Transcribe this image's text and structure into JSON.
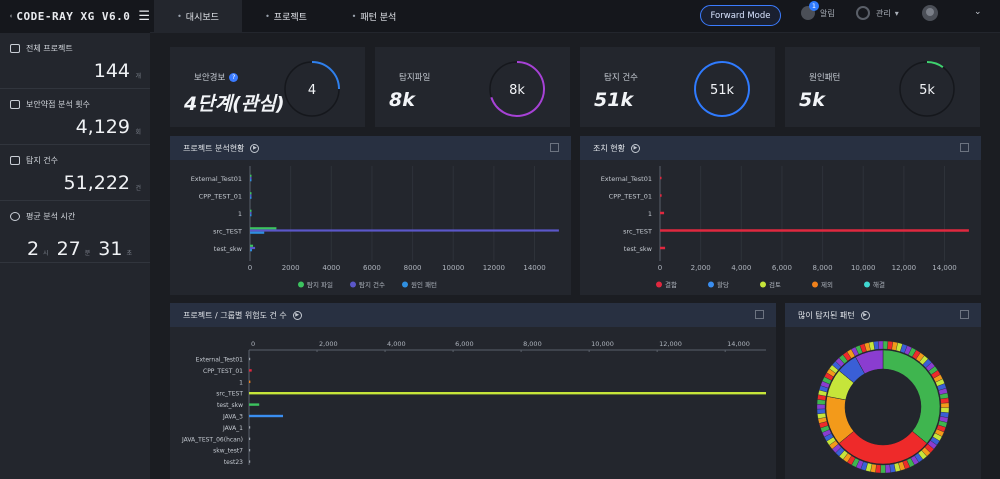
{
  "app": {
    "logo": "CODE-RAY XG V6.0"
  },
  "nav": {
    "tabs": [
      "대시보드",
      "프로젝트",
      "패턴 분석"
    ],
    "active": 0
  },
  "header": {
    "forward_mode": "Forward Mode",
    "alarm_label": "알림",
    "alarm_count": "1",
    "manage_label": "관리"
  },
  "sidebar": {
    "stats": [
      {
        "label": "전체 프로젝트",
        "value": "144",
        "unit": "개"
      },
      {
        "label": "보안약점 분석 횟수",
        "value": "4,129",
        "unit": "회"
      },
      {
        "label": "탐지 건수",
        "value": "51,222",
        "unit": "건"
      }
    ],
    "avg_time": {
      "label": "평균 분석 시간",
      "h": "2",
      "h_unit": "시",
      "m": "27",
      "m_unit": "분",
      "s": "31",
      "s_unit": "초"
    }
  },
  "kpis": [
    {
      "label": "보안경보",
      "value": "4단계(관심)",
      "ring": "4",
      "fraction": 0.25,
      "color": "#2f80ed",
      "help": "?"
    },
    {
      "label": "탐지파일",
      "value": "8k",
      "ring": "8k",
      "fraction": 0.7,
      "color": "#a742d6"
    },
    {
      "label": "탐지 건수",
      "value": "51k",
      "ring": "51k",
      "fraction": 1.0,
      "color": "#2f7bff"
    },
    {
      "label": "원인패턴",
      "value": "5k",
      "ring": "5k",
      "fraction": 0.1,
      "color": "#3fd36f"
    }
  ],
  "panels": {
    "project_analysis": {
      "title": "프로젝트 분석현황"
    },
    "action_status": {
      "title": "조치 현황"
    },
    "risk_by_group": {
      "title": "프로젝트 / 그룹별 위험도 건 수"
    },
    "top_patterns": {
      "title": "많이 탐지된 패턴"
    }
  },
  "chart_data": [
    {
      "type": "bar",
      "title": "프로젝트 분석현황",
      "categories": [
        "External_Test01",
        "CPP_TEST_01",
        "1",
        "src_TEST",
        "test_skw"
      ],
      "series": [
        {
          "name": "탐지 파일",
          "color": "#3cc35f",
          "values": [
            20,
            10,
            10,
            1300,
            150
          ]
        },
        {
          "name": "탐지 건수",
          "color": "#5b57c9",
          "values": [
            50,
            30,
            20,
            15200,
            250
          ]
        },
        {
          "name": "원인 패턴",
          "color": "#2f8fe0",
          "values": [
            10,
            10,
            5,
            700,
            100
          ]
        }
      ],
      "xlim": [
        0,
        15500
      ],
      "xticks": [
        0,
        2000,
        4000,
        6000,
        8000,
        10000,
        12000,
        14000
      ]
    },
    {
      "type": "bar",
      "title": "조치 현황",
      "categories": [
        "External_Test01",
        "CPP_TEST_01",
        "1",
        "src_TEST",
        "test_skw"
      ],
      "series": [
        {
          "name": "결함",
          "color": "#e0283f",
          "values": [
            60,
            80,
            200,
            15200,
            250
          ]
        },
        {
          "name": "할당",
          "color": "#3a8ef0",
          "values": [
            0,
            0,
            0,
            0,
            0
          ]
        },
        {
          "name": "검토",
          "color": "#c6e53a",
          "values": [
            0,
            0,
            0,
            0,
            0
          ]
        },
        {
          "name": "제외",
          "color": "#f0811b",
          "values": [
            0,
            0,
            0,
            0,
            0
          ]
        },
        {
          "name": "해결",
          "color": "#3fd7d0",
          "values": [
            0,
            0,
            0,
            0,
            0
          ]
        }
      ],
      "xlim": [
        0,
        15500
      ],
      "xticks": [
        "0",
        "2,000",
        "4,000",
        "6,000",
        "8,000",
        "10,000",
        "12,000",
        "14,000"
      ]
    },
    {
      "type": "bar",
      "title": "프로젝트 / 그룹별 위험도 건 수",
      "categories": [
        "External_Test01",
        "CPP_TEST_01",
        "1",
        "src_TEST",
        "test_skw",
        "JAVA_3",
        "JAVA_1",
        "JAVA_TEST_06(hcan)",
        "skw_test7",
        "test23"
      ],
      "series": [
        {
          "name": "risk",
          "values": [
            30,
            80,
            40,
            15200,
            300,
            1000,
            20,
            10,
            10,
            10
          ],
          "colors": [
            "#9aa0a8",
            "#e0283f",
            "#f0811b",
            "#c6e53a",
            "#3cc35f",
            "#3a8ef0",
            "#9aa0a8",
            "#9aa0a8",
            "#9aa0a8",
            "#9aa0a8"
          ]
        }
      ],
      "xlim": [
        0,
        15200
      ],
      "xticks": [
        "0",
        "2,000",
        "4,000",
        "6,000",
        "8,000",
        "10,000",
        "12,000",
        "14,000"
      ]
    },
    {
      "type": "pie",
      "title": "많이 탐지된 패턴",
      "values": [
        36,
        28,
        14,
        8,
        6,
        8
      ],
      "colors": [
        "#3fb54f",
        "#ee2a2a",
        "#f39a1a",
        "#c6e53a",
        "#3a5fd6",
        "#8a3dd0"
      ]
    }
  ]
}
